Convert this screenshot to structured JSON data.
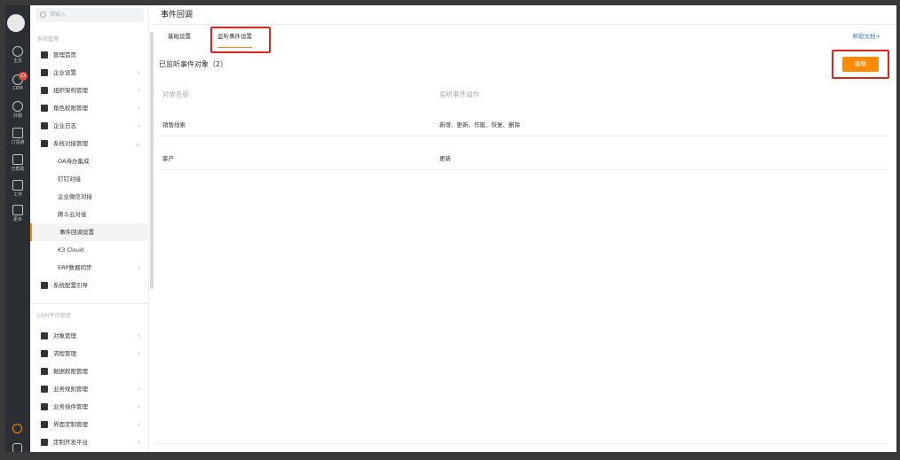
{
  "rail": {
    "items": [
      {
        "label": "主页",
        "icon": "chat-icon"
      },
      {
        "label": "CRM",
        "icon": "crm-icon",
        "badge": "12"
      },
      {
        "label": "外勤",
        "icon": "location-icon"
      },
      {
        "label": "订货通",
        "icon": "box-icon"
      },
      {
        "label": "已帮助",
        "icon": "storefront-icon"
      },
      {
        "label": "工作",
        "icon": "briefcase-icon"
      },
      {
        "label": "更多",
        "icon": "grid-icon"
      }
    ]
  },
  "sidebar": {
    "search_placeholder": "请输入",
    "group1_title": "系统管理",
    "group1": [
      {
        "label": "管理首页",
        "icon": "home-icon",
        "chevron": ""
      },
      {
        "label": "企业设置",
        "icon": "building-icon",
        "chevron": "›"
      },
      {
        "label": "组织架构管理",
        "icon": "org-chart-icon",
        "chevron": "›"
      },
      {
        "label": "角色权限管理",
        "icon": "id-card-icon",
        "chevron": "›"
      },
      {
        "label": "企业日志",
        "icon": "log-icon",
        "chevron": "›"
      },
      {
        "label": "系统对接管理",
        "icon": "link-icon",
        "chevron": "⌄"
      }
    ],
    "sub_items": [
      {
        "label": "OA待办集成"
      },
      {
        "label": "钉钉对接"
      },
      {
        "label": "企业微信对接"
      },
      {
        "label": "腾斗云对接"
      },
      {
        "label": "事件回调设置"
      },
      {
        "label": "K3 Cloud"
      },
      {
        "label": "ERP数据同步",
        "chevron": "›"
      }
    ],
    "guide": {
      "label": "系统配置引导",
      "icon": "settings-guide-icon"
    },
    "group2_title": "CRM平台管理",
    "group2": [
      {
        "label": "对象管理",
        "icon": "object-icon",
        "chevron": "›"
      },
      {
        "label": "流程管理",
        "icon": "flow-icon",
        "chevron": "›"
      },
      {
        "label": "数据权限管理",
        "icon": "lock-icon",
        "chevron": ""
      },
      {
        "label": "业务规则管理",
        "icon": "wrench-icon",
        "chevron": "›"
      },
      {
        "label": "业务插件管理",
        "icon": "puzzle-icon",
        "chevron": "›"
      },
      {
        "label": "界面定制管理",
        "icon": "layout-icon",
        "chevron": "›"
      },
      {
        "label": "定制开发平台",
        "icon": "code-icon",
        "chevron": "›"
      }
    ]
  },
  "main": {
    "title": "事件回调",
    "tabs": [
      {
        "label": "基础设置"
      },
      {
        "label": "监听事件设置"
      }
    ],
    "help_link": "帮助文档>",
    "section_title": "已监听事件对象（2）",
    "edit_label": "编辑",
    "columns": [
      "对象名称",
      "监听事件动作"
    ],
    "rows": [
      {
        "object": "销售线索",
        "actions": "新增、更新、作废、恢复、删除"
      },
      {
        "object": "客户",
        "actions": "更新"
      }
    ]
  },
  "colors": {
    "accent": "#ff8a00",
    "highlight": "#e3241b",
    "link": "#2f7fd1",
    "rail": "#2b2e33"
  }
}
